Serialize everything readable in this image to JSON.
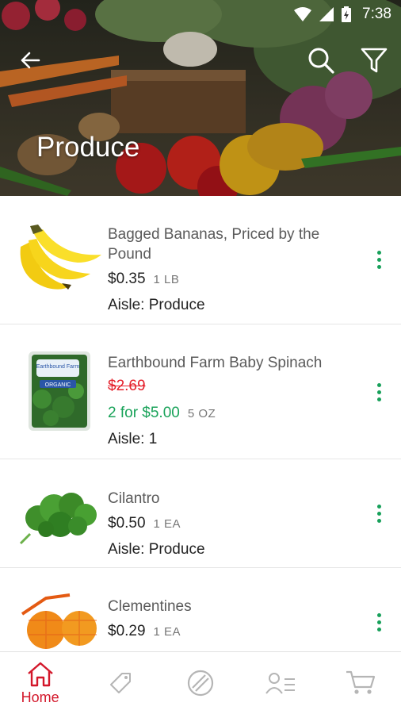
{
  "status": {
    "time": "7:38"
  },
  "header": {
    "title": "Produce"
  },
  "products": [
    {
      "name": "Bagged Bananas, Priced by the Pound",
      "price": "$0.35",
      "unit": "1 LB",
      "aisle": "Aisle: Produce"
    },
    {
      "name": "Earthbound Farm Baby Spinach",
      "original_price": "$2.69",
      "sale_price": "2 for $5.00",
      "unit": "5 OZ",
      "aisle": "Aisle:  1",
      "package_brand": "Earthbound Farm",
      "package_label": "ORGANIC"
    },
    {
      "name": "Cilantro",
      "price": "$0.50",
      "unit": "1 EA",
      "aisle": "Aisle: Produce"
    },
    {
      "name": "Clementines",
      "price": "$0.29",
      "unit": "1 EA"
    }
  ],
  "nav": [
    {
      "label": "Home",
      "icon": "home-icon",
      "active": true
    },
    {
      "label": "",
      "icon": "tag-icon"
    },
    {
      "label": "",
      "icon": "circle-slash-icon"
    },
    {
      "label": "",
      "icon": "account-list-icon"
    },
    {
      "label": "",
      "icon": "cart-icon"
    }
  ],
  "colors": {
    "accent": "#d3172a",
    "sale": "#1aa35a",
    "strike": "#e5202b",
    "more": "#17a05a"
  }
}
